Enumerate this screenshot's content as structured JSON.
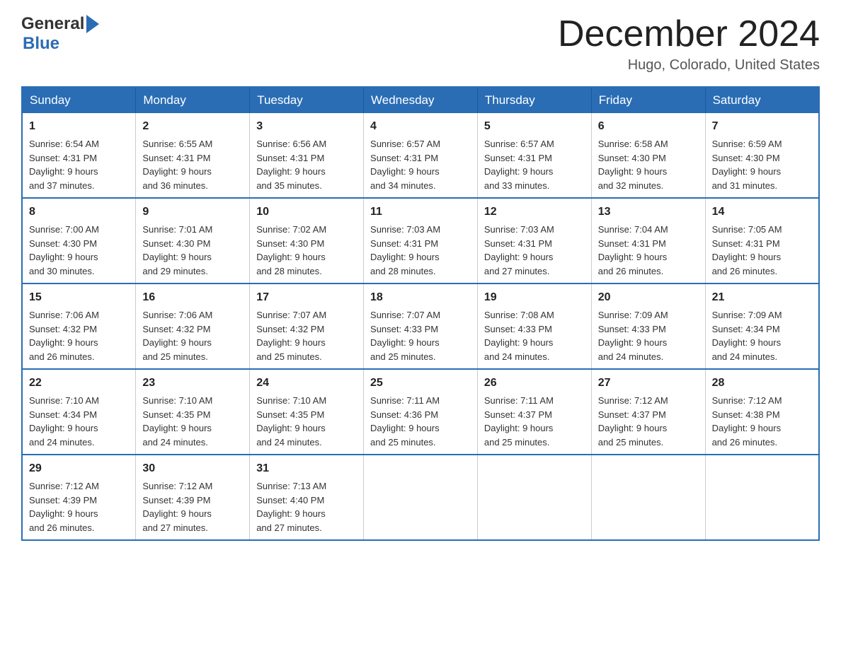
{
  "header": {
    "logo_general": "General",
    "logo_blue": "Blue",
    "title": "December 2024",
    "location": "Hugo, Colorado, United States"
  },
  "calendar": {
    "days_of_week": [
      "Sunday",
      "Monday",
      "Tuesday",
      "Wednesday",
      "Thursday",
      "Friday",
      "Saturday"
    ],
    "weeks": [
      [
        {
          "day": "1",
          "sunrise": "6:54 AM",
          "sunset": "4:31 PM",
          "daylight": "9 hours and 37 minutes."
        },
        {
          "day": "2",
          "sunrise": "6:55 AM",
          "sunset": "4:31 PM",
          "daylight": "9 hours and 36 minutes."
        },
        {
          "day": "3",
          "sunrise": "6:56 AM",
          "sunset": "4:31 PM",
          "daylight": "9 hours and 35 minutes."
        },
        {
          "day": "4",
          "sunrise": "6:57 AM",
          "sunset": "4:31 PM",
          "daylight": "9 hours and 34 minutes."
        },
        {
          "day": "5",
          "sunrise": "6:57 AM",
          "sunset": "4:31 PM",
          "daylight": "9 hours and 33 minutes."
        },
        {
          "day": "6",
          "sunrise": "6:58 AM",
          "sunset": "4:30 PM",
          "daylight": "9 hours and 32 minutes."
        },
        {
          "day": "7",
          "sunrise": "6:59 AM",
          "sunset": "4:30 PM",
          "daylight": "9 hours and 31 minutes."
        }
      ],
      [
        {
          "day": "8",
          "sunrise": "7:00 AM",
          "sunset": "4:30 PM",
          "daylight": "9 hours and 30 minutes."
        },
        {
          "day": "9",
          "sunrise": "7:01 AM",
          "sunset": "4:30 PM",
          "daylight": "9 hours and 29 minutes."
        },
        {
          "day": "10",
          "sunrise": "7:02 AM",
          "sunset": "4:30 PM",
          "daylight": "9 hours and 28 minutes."
        },
        {
          "day": "11",
          "sunrise": "7:03 AM",
          "sunset": "4:31 PM",
          "daylight": "9 hours and 28 minutes."
        },
        {
          "day": "12",
          "sunrise": "7:03 AM",
          "sunset": "4:31 PM",
          "daylight": "9 hours and 27 minutes."
        },
        {
          "day": "13",
          "sunrise": "7:04 AM",
          "sunset": "4:31 PM",
          "daylight": "9 hours and 26 minutes."
        },
        {
          "day": "14",
          "sunrise": "7:05 AM",
          "sunset": "4:31 PM",
          "daylight": "9 hours and 26 minutes."
        }
      ],
      [
        {
          "day": "15",
          "sunrise": "7:06 AM",
          "sunset": "4:32 PM",
          "daylight": "9 hours and 26 minutes."
        },
        {
          "day": "16",
          "sunrise": "7:06 AM",
          "sunset": "4:32 PM",
          "daylight": "9 hours and 25 minutes."
        },
        {
          "day": "17",
          "sunrise": "7:07 AM",
          "sunset": "4:32 PM",
          "daylight": "9 hours and 25 minutes."
        },
        {
          "day": "18",
          "sunrise": "7:07 AM",
          "sunset": "4:33 PM",
          "daylight": "9 hours and 25 minutes."
        },
        {
          "day": "19",
          "sunrise": "7:08 AM",
          "sunset": "4:33 PM",
          "daylight": "9 hours and 24 minutes."
        },
        {
          "day": "20",
          "sunrise": "7:09 AM",
          "sunset": "4:33 PM",
          "daylight": "9 hours and 24 minutes."
        },
        {
          "day": "21",
          "sunrise": "7:09 AM",
          "sunset": "4:34 PM",
          "daylight": "9 hours and 24 minutes."
        }
      ],
      [
        {
          "day": "22",
          "sunrise": "7:10 AM",
          "sunset": "4:34 PM",
          "daylight": "9 hours and 24 minutes."
        },
        {
          "day": "23",
          "sunrise": "7:10 AM",
          "sunset": "4:35 PM",
          "daylight": "9 hours and 24 minutes."
        },
        {
          "day": "24",
          "sunrise": "7:10 AM",
          "sunset": "4:35 PM",
          "daylight": "9 hours and 24 minutes."
        },
        {
          "day": "25",
          "sunrise": "7:11 AM",
          "sunset": "4:36 PM",
          "daylight": "9 hours and 25 minutes."
        },
        {
          "day": "26",
          "sunrise": "7:11 AM",
          "sunset": "4:37 PM",
          "daylight": "9 hours and 25 minutes."
        },
        {
          "day": "27",
          "sunrise": "7:12 AM",
          "sunset": "4:37 PM",
          "daylight": "9 hours and 25 minutes."
        },
        {
          "day": "28",
          "sunrise": "7:12 AM",
          "sunset": "4:38 PM",
          "daylight": "9 hours and 26 minutes."
        }
      ],
      [
        {
          "day": "29",
          "sunrise": "7:12 AM",
          "sunset": "4:39 PM",
          "daylight": "9 hours and 26 minutes."
        },
        {
          "day": "30",
          "sunrise": "7:12 AM",
          "sunset": "4:39 PM",
          "daylight": "9 hours and 27 minutes."
        },
        {
          "day": "31",
          "sunrise": "7:13 AM",
          "sunset": "4:40 PM",
          "daylight": "9 hours and 27 minutes."
        },
        null,
        null,
        null,
        null
      ]
    ],
    "labels": {
      "sunrise": "Sunrise: ",
      "sunset": "Sunset: ",
      "daylight": "Daylight: "
    }
  }
}
